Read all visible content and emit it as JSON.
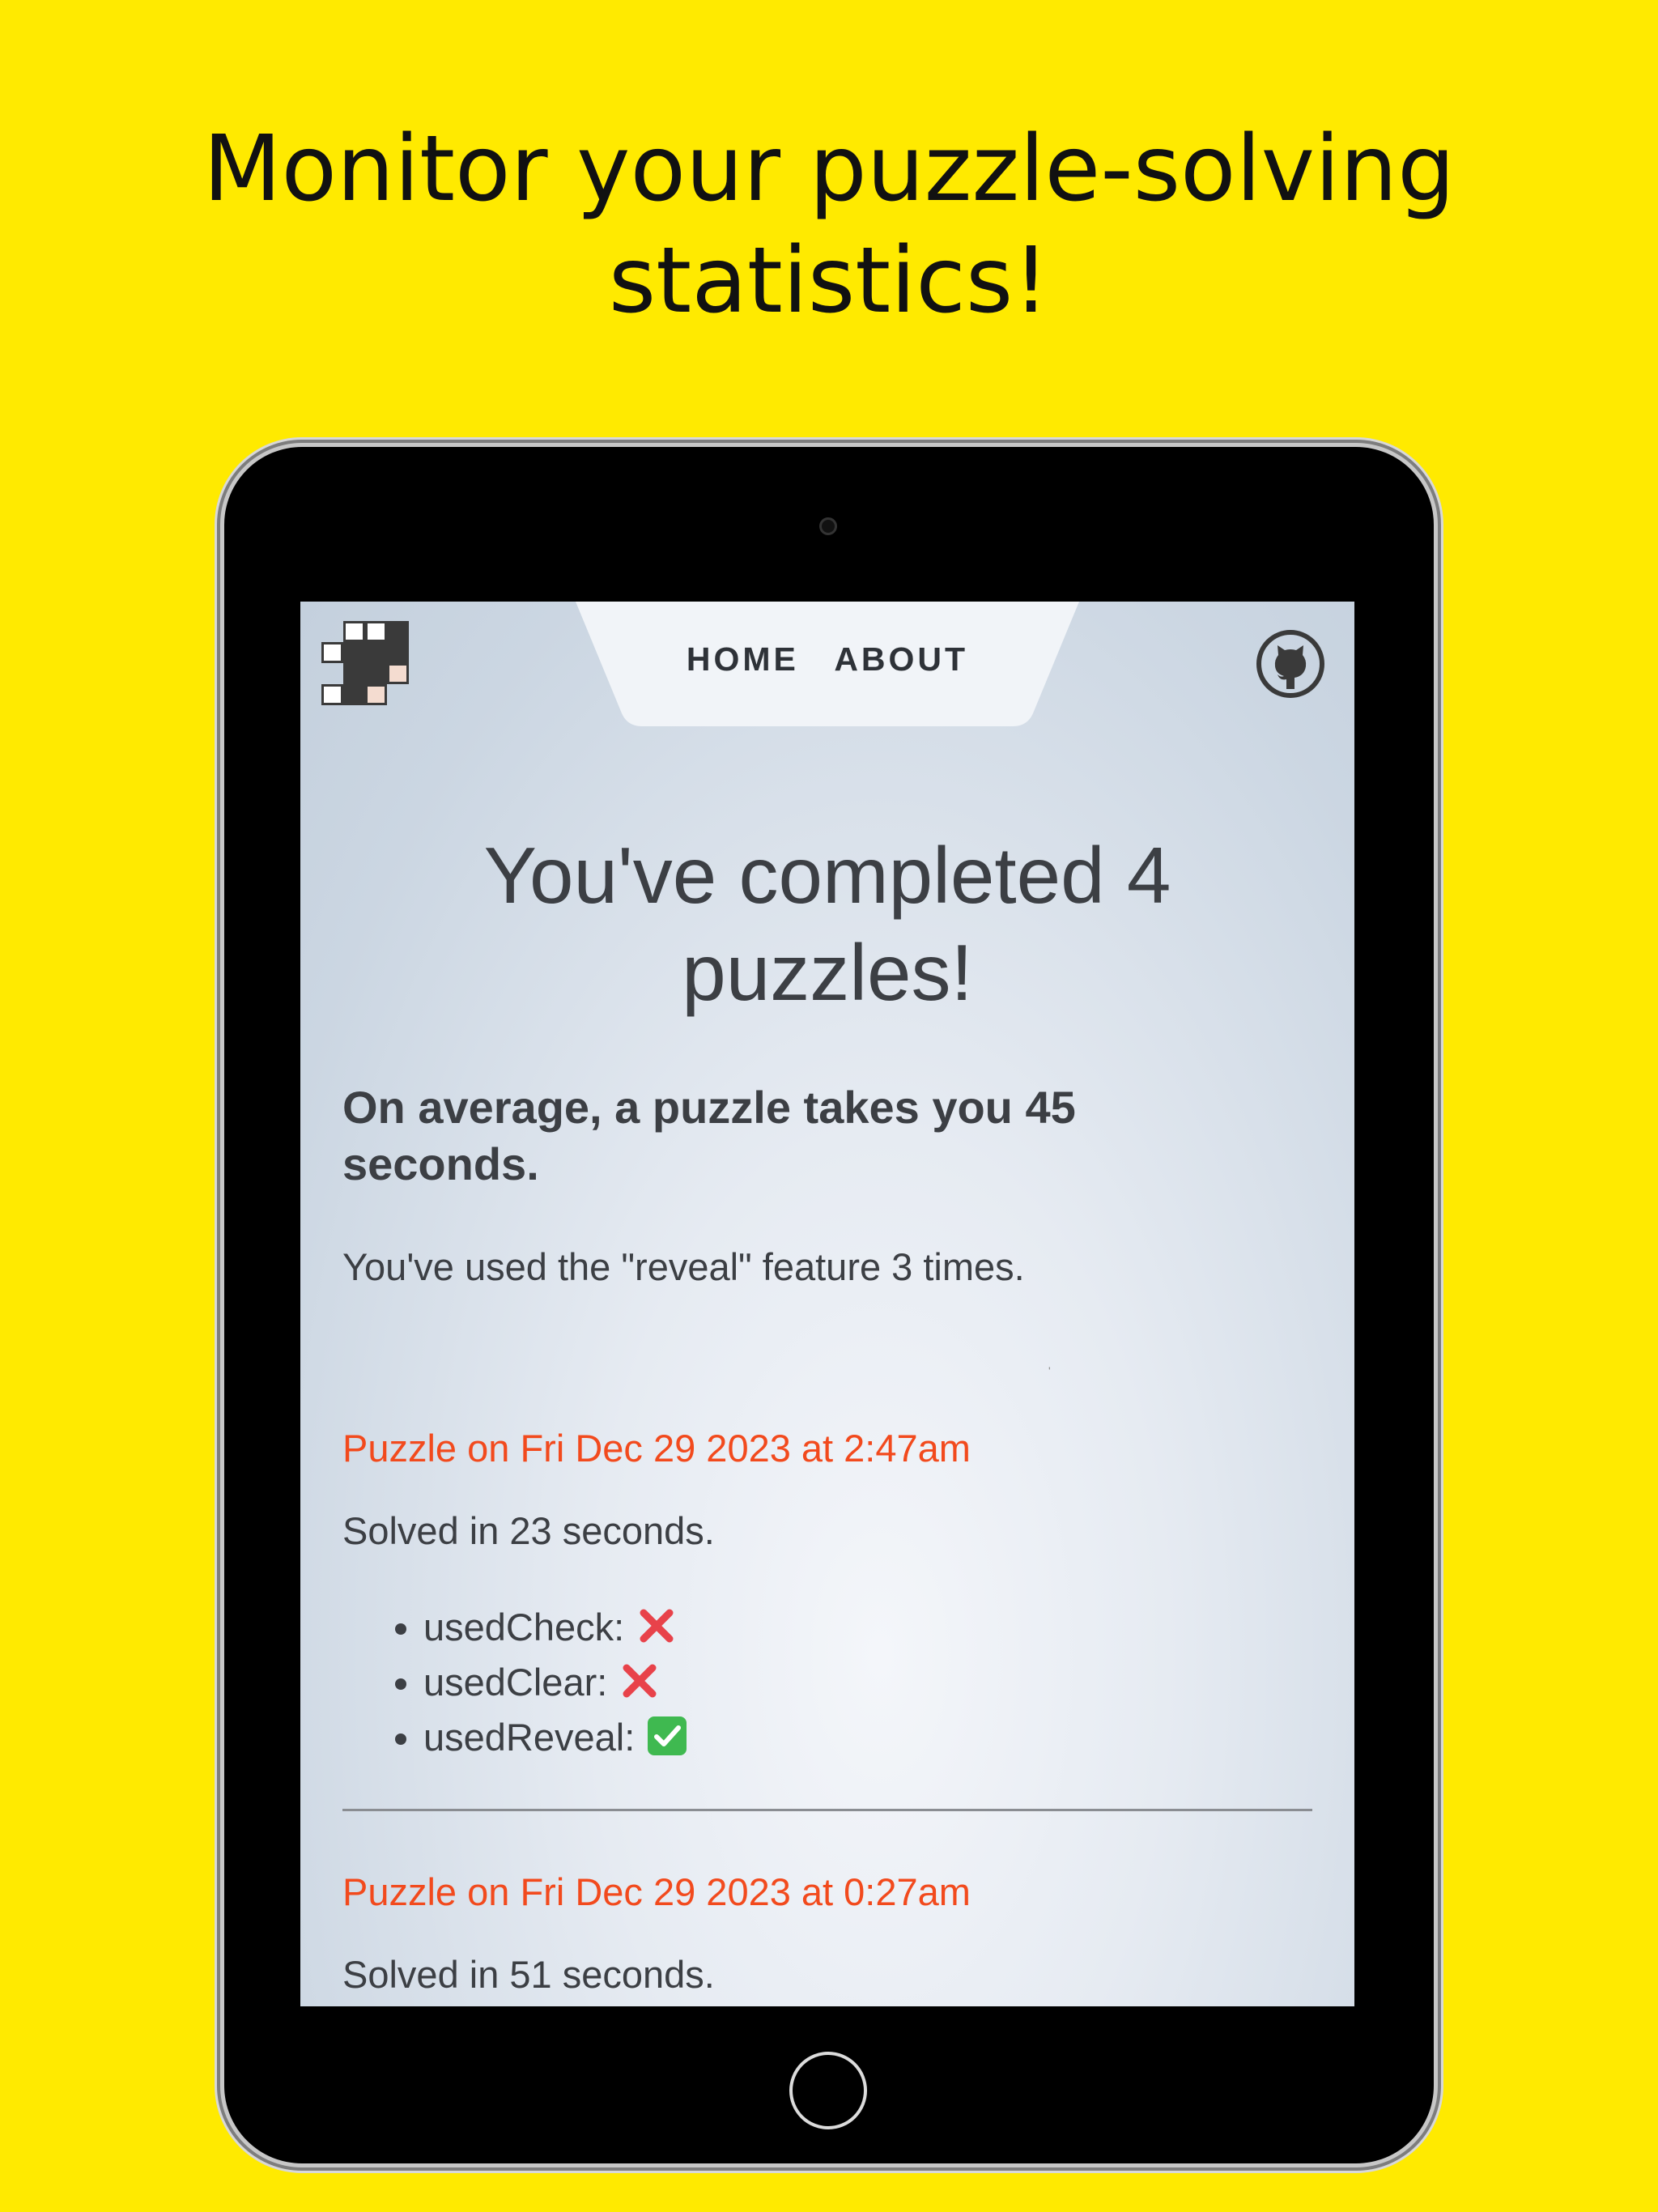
{
  "headline": {
    "line1": "Monitor your puzzle-solving",
    "line2": "statistics!"
  },
  "nav": {
    "home": "HOME",
    "about": "ABOUT",
    "logo_icon": "crossword-grid-logo-icon",
    "github_icon": "github-icon"
  },
  "stats": {
    "title": "You've completed 4 puzzles!",
    "average": "On average, a puzzle takes you 45 seconds.",
    "reveal": "You've used the \"reveal\" feature 3 times."
  },
  "puzzles": [
    {
      "date": "Puzzle on Fri Dec 29 2023 at 2:47am",
      "solved": "Solved in 23 seconds.",
      "flags": [
        {
          "label": "usedCheck:",
          "value": "no",
          "icon": "red-x-icon"
        },
        {
          "label": "usedClear:",
          "value": "no",
          "icon": "red-x-icon"
        },
        {
          "label": "usedReveal:",
          "value": "yes",
          "icon": "green-check-icon"
        }
      ]
    },
    {
      "date": "Puzzle on Fri Dec 29 2023 at 0:27am",
      "solved": "Solved in 51 seconds."
    }
  ],
  "colors": {
    "background": "#ffea00",
    "puzzle_date": "#f24a1d",
    "body_text": "#3c3f44",
    "cross": "#e8424a",
    "check": "#3fb950"
  }
}
